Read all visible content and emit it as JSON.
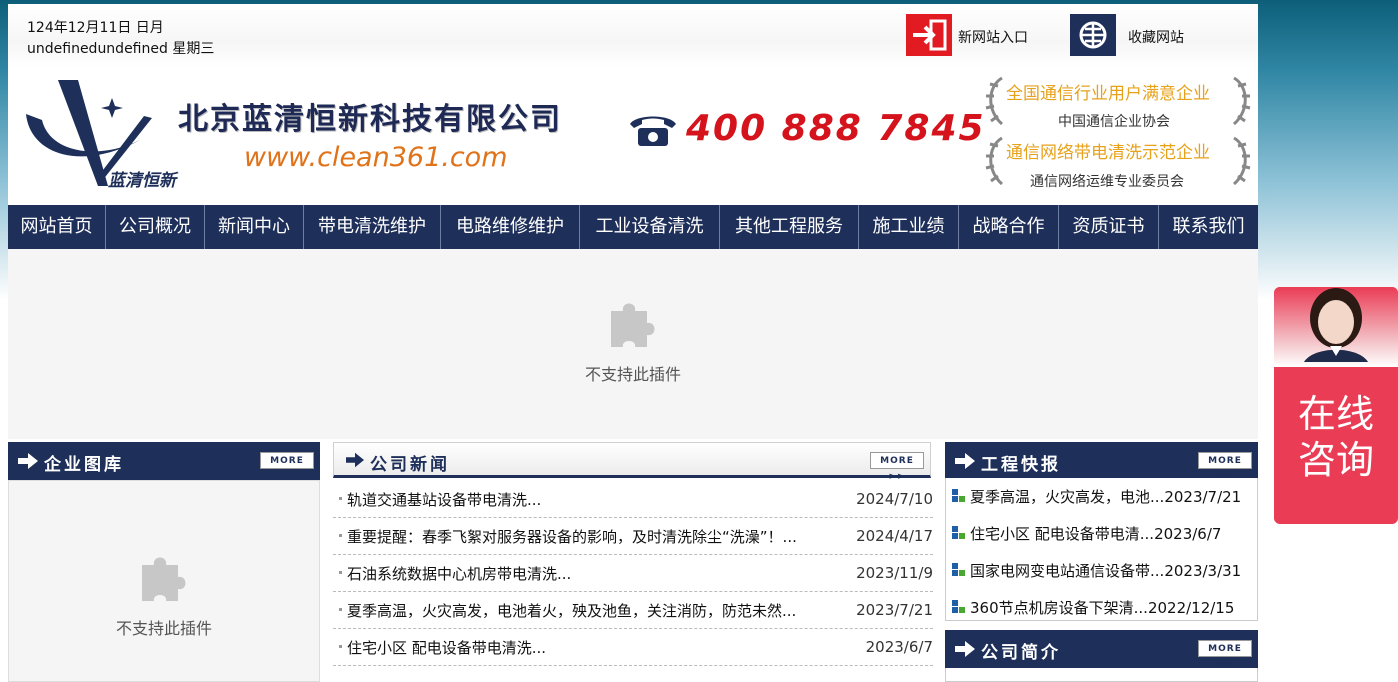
{
  "topbar": {
    "date_line1": "124年12月11日 日月",
    "date_line2": "undefinedundefined 星期三",
    "new_site_label": "新网站入口",
    "bookmark_label": "收藏网站"
  },
  "header": {
    "logo_text": "蓝清恒新",
    "company_name": "北京蓝清恒新科技有限公司",
    "website": "www.clean361.com",
    "phone": "400 888 7845",
    "award1_title": "全国通信行业用户满意企业",
    "award1_org": "中国通信企业协会",
    "award2_title": "通信网络带电清洗示范企业",
    "award2_org": "通信网络运维专业委员会"
  },
  "nav": {
    "items": [
      {
        "label": "网站首页"
      },
      {
        "label": "公司概况"
      },
      {
        "label": "新闻中心"
      },
      {
        "label": "带电清洗维护"
      },
      {
        "label": "电路维修维护"
      },
      {
        "label": "工业设备清洗"
      },
      {
        "label": "其他工程服务"
      },
      {
        "label": "施工业绩"
      },
      {
        "label": "战略合作"
      },
      {
        "label": "资质证书"
      },
      {
        "label": "联系我们"
      }
    ]
  },
  "plugin": {
    "unsupported_text": "不支持此插件"
  },
  "more_label": "MORE >>",
  "gallery": {
    "title": "企业图库"
  },
  "news": {
    "title": "公司新闻",
    "items": [
      {
        "title": "轨道交通基站设备带电清洗...",
        "date": "2024/7/10"
      },
      {
        "title": "重要提醒：春季飞絮对服务器设备的影响，及时清洗除尘“洗澡”！...",
        "date": "2024/4/17"
      },
      {
        "title": "石油系统数据中心机房带电清洗...",
        "date": "2023/11/9"
      },
      {
        "title": "夏季高温，火灾高发，电池着火，殃及池鱼，关注消防，防范未然...",
        "date": "2023/7/21"
      },
      {
        "title": "住宅小区 配电设备带电清洗...",
        "date": "2023/6/7"
      }
    ]
  },
  "projects": {
    "title": "工程快报",
    "items": [
      {
        "title": "夏季高温，火灾高发，电池...",
        "date": "2023/7/21"
      },
      {
        "title": "住宅小区 配电设备带电清...",
        "date": "2023/6/7"
      },
      {
        "title": "国家电网变电站通信设备带...",
        "date": "2023/3/31"
      },
      {
        "title": "360节点机房设备下架清...",
        "date": "2022/12/15"
      }
    ]
  },
  "profile": {
    "title": "公司简介"
  },
  "consult": {
    "label_line1": "在线",
    "label_line2": "咨询"
  },
  "colors": {
    "nav_bg": "#1e2f5a",
    "phone_red": "#d4131c",
    "url_orange": "#e0731a",
    "award_gold": "#e7a21c",
    "consult_pink": "#ea3c55"
  }
}
